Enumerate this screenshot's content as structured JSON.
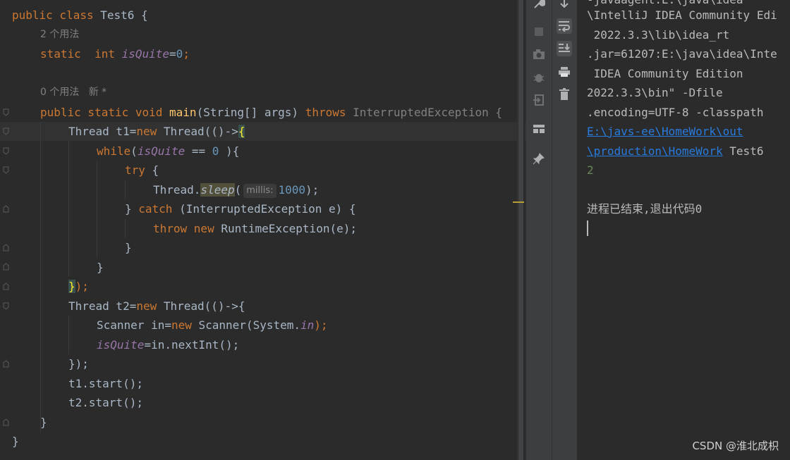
{
  "editor": {
    "top_hint": "0 个用法  新 *",
    "lines": {
      "l1": {
        "kw": "public class ",
        "rest": "Test6 {"
      },
      "usages_2": "2 个用法",
      "l3": {
        "kw1": "static  ",
        "kw2": "int ",
        "fld": "isQuite",
        "eq": "=",
        "num": "0",
        "semi": ";"
      },
      "usages_0": "0 个用法   新 *",
      "l5": {
        "kw": "public static void ",
        "fn": "main",
        "args": "(String[] args) ",
        "throws": "throws ",
        "exc": "InterruptedException {"
      },
      "l6": {
        "a": "Thread t1=",
        "kw": "new ",
        "b": "Thread(()->",
        "brace": "{"
      },
      "l7": {
        "kw": "while",
        "a": "(",
        "fld": "isQuite",
        "b": " == ",
        "num": "0",
        "c": " ){"
      },
      "l8": {
        "kw": "try",
        "a": " {"
      },
      "l9": {
        "a": "Thread.",
        "sleep": "sleep",
        "b": "(",
        "hint": "millis:",
        "num": "1000",
        "c": ");"
      },
      "l10": {
        "a": "} ",
        "kw": "catch",
        "b": " (InterruptedException e) {"
      },
      "l11": {
        "kw1": "throw ",
        "kw2": "new ",
        "a": "RuntimeException(e);"
      },
      "l12": "}",
      "l13": "}",
      "l14": {
        "brace": "}",
        "a": ");"
      },
      "l15": {
        "a": "Thread t2=",
        "kw": "new ",
        "b": "Thread(()->{"
      },
      "l16": {
        "a": "Scanner in=",
        "kw": "new ",
        "b": "Scanner(System.",
        "fld": "in",
        "c": ");"
      },
      "l17": {
        "fld": "isQuite",
        "a": "=in.nextInt();"
      },
      "l18": "});",
      "l19": "t1.start();",
      "l20": "t2.start();",
      "l21": "}",
      "l22": "}"
    }
  },
  "console": {
    "lines": [
      "-javaagent:E:\\java\\idea",
      "\\IntelliJ IDEA Community Edi",
      " 2022.3.3\\lib\\idea_rt",
      ".jar=61207:E:\\java\\idea\\Inte",
      " IDEA Community Edition",
      "2022.3.3\\bin\" -Dfile",
      ".encoding=UTF-8 -classpath"
    ],
    "link1": "E:\\javs-ee\\HomeWork\\out",
    "link2": "\\production\\HomeWork",
    "link2_tail": " Test6",
    "input_echo": "2",
    "exit_msg": "进程已结束,退出代码0"
  },
  "toolbar": {
    "icons": [
      "wrench-icon",
      "stop-icon",
      "camera-icon",
      "debug-icon",
      "exit-icon",
      "layout-icon",
      "pin-icon"
    ],
    "icons2": [
      "down-arrow-icon",
      "soft-wrap-icon",
      "scroll-to-end-icon",
      "print-icon",
      "trash-icon"
    ]
  },
  "watermark": "CSDN @淮北成枳"
}
